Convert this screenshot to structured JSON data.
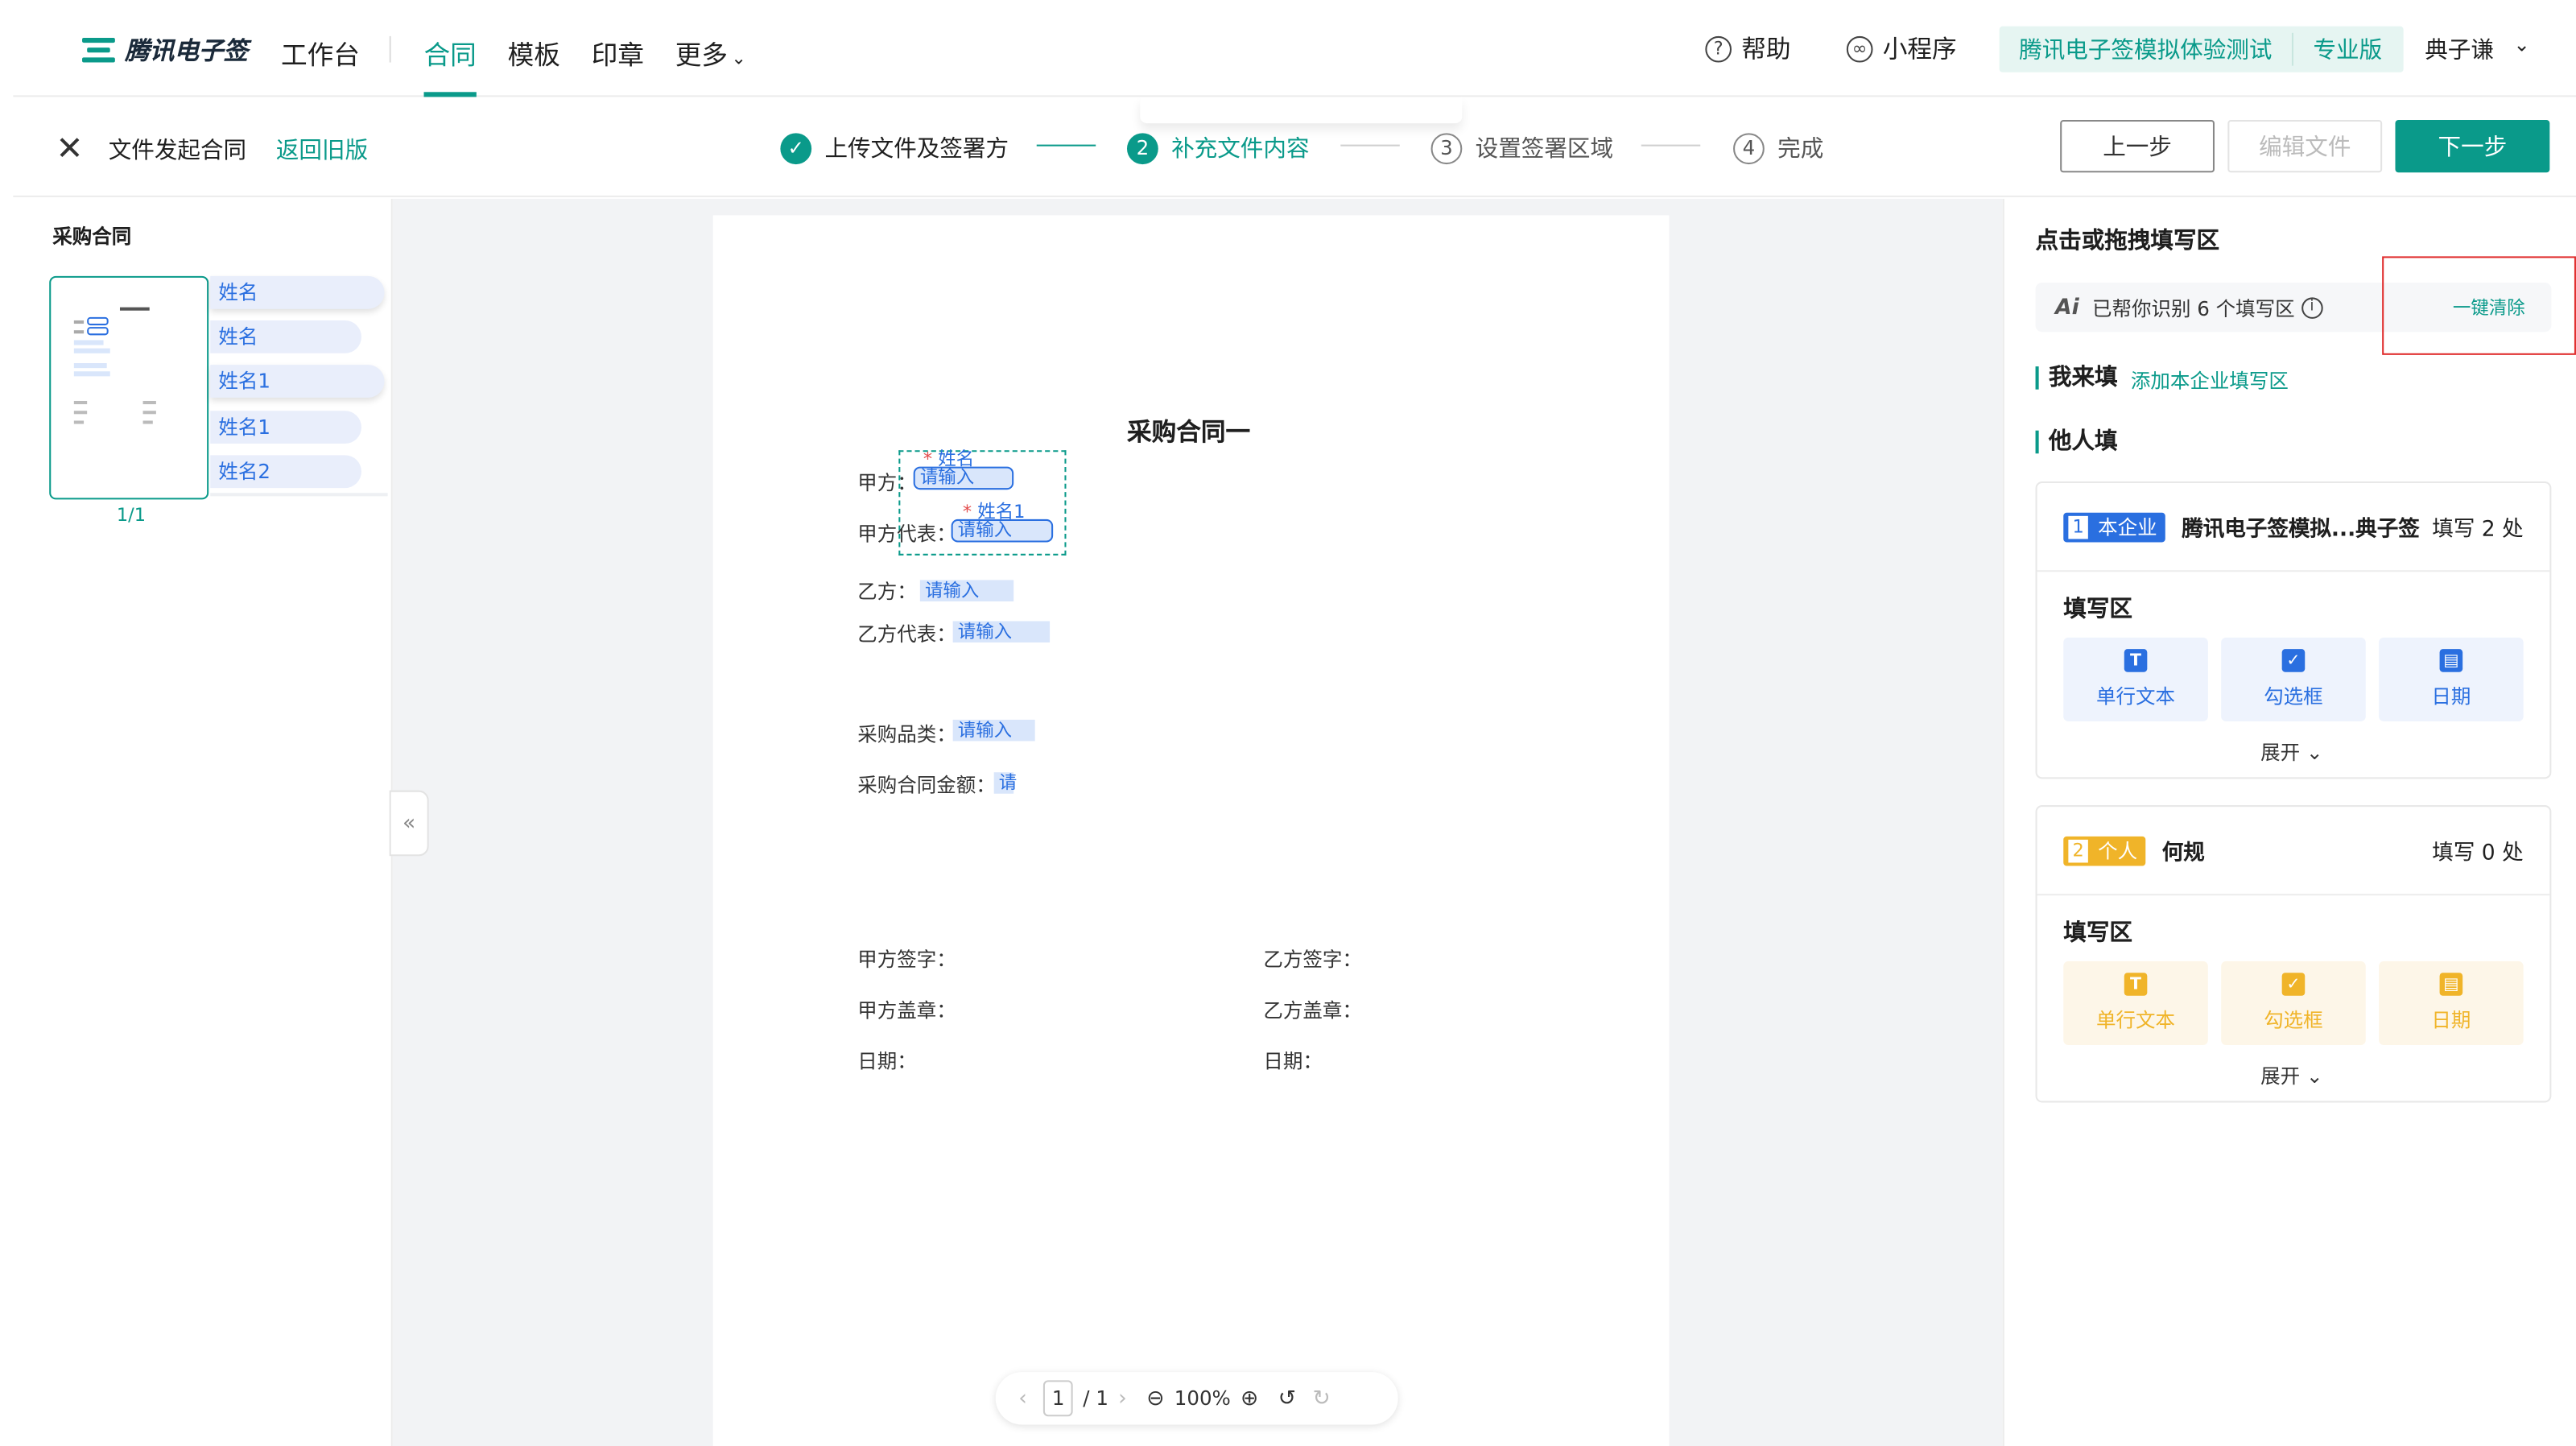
{
  "nav": {
    "logo_text": "腾讯电子签",
    "workbench": "工作台",
    "contract": "合同",
    "template": "模板",
    "seal": "印章",
    "more": "更多",
    "help": "帮助",
    "miniapp": "小程序",
    "org_name": "腾讯电子签模拟体验测试",
    "org_version": "专业版",
    "user": "典子谦"
  },
  "subbar": {
    "title": "文件发起合同",
    "back_old": "返回旧版",
    "steps": [
      {
        "num": "✓",
        "label": "上传文件及签署方",
        "state": "done"
      },
      {
        "num": "2",
        "label": "补充文件内容",
        "state": "active"
      },
      {
        "num": "3",
        "label": "设置签署区域",
        "state": "todo"
      },
      {
        "num": "4",
        "label": "完成",
        "state": "todo"
      }
    ],
    "prev_btn": "上一步",
    "edit_btn": "编辑文件",
    "next_btn": "下一步"
  },
  "left": {
    "title": "采购合同",
    "page_label": "1/1",
    "fields": [
      "姓名",
      "姓名",
      "姓名1",
      "姓名1",
      "姓名2"
    ]
  },
  "doc": {
    "title": "采购合同一",
    "party_a": "甲方：",
    "party_a_rep": "甲方代表：",
    "party_b": "乙方：",
    "party_b_rep": "乙方代表：",
    "category": "采购品类：",
    "amount": "采购合同金额：",
    "sign_a": "甲方签字：",
    "sign_b": "乙方签字：",
    "seal_a": "甲方盖章：",
    "seal_b": "乙方盖章：",
    "date_a": "日期：",
    "date_b": "日期：",
    "placeholder": "请输入",
    "placeholder_short": "请",
    "field_name": "姓名",
    "field_name1": "姓名1",
    "required_mark": "*"
  },
  "pager": {
    "current": "1",
    "total": "/ 1",
    "zoom": "100%"
  },
  "right": {
    "title": "点击或拖拽填写区",
    "ai_icon": "Ai",
    "ai_text": "已帮你识别 6 个填写区",
    "clear_all": "一键清除",
    "self_fill": "我来填",
    "add_company_field": "添加本企业填写区",
    "others_fill": "他人填",
    "cards": [
      {
        "num": "1",
        "tag": "本企业",
        "name": "腾讯电子签模拟...典子签",
        "count": "填写 2 处",
        "fill_area": "填写区",
        "tools": [
          "单行文本",
          "勾选框",
          "日期"
        ],
        "expand": "展开"
      },
      {
        "num": "2",
        "tag": "个人",
        "name": "何规",
        "count": "填写 0 处",
        "fill_area": "填写区",
        "tools": [
          "单行文本",
          "勾选框",
          "日期"
        ],
        "expand": "展开"
      }
    ]
  },
  "colors": {
    "brand": "#0a9a8a",
    "field_blue": "#2a6fe0",
    "personal_orange": "#f0b429",
    "highlight_red": "#e02d2d"
  }
}
